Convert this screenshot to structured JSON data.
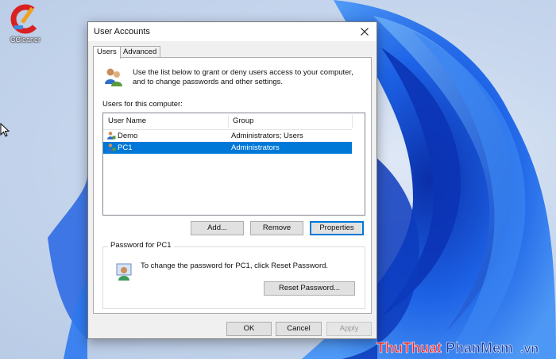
{
  "desktop": {
    "icons": [
      {
        "label": "CCleaner",
        "icon": "ccleaner-icon"
      }
    ],
    "watermark": "ThuThuatPhanMem.vn"
  },
  "dialog": {
    "title": "User Accounts",
    "tabs": [
      {
        "label": "Users",
        "active": true
      },
      {
        "label": "Advanced",
        "active": false
      }
    ],
    "intro_line1": "Use the list below to grant or deny users access to your computer,",
    "intro_line2": "and to change passwords and other settings.",
    "users_label": "Users for this computer:",
    "columns": [
      "User Name",
      "Group"
    ],
    "users": [
      {
        "name": "Demo",
        "group": "Administrators; Users",
        "selected": false
      },
      {
        "name": "PC1",
        "group": "Administrators",
        "selected": true
      }
    ],
    "list_buttons": {
      "add": "Add...",
      "remove": "Remove",
      "properties": "Properties"
    },
    "password_group": {
      "legend": "Password for PC1",
      "text": "To change the password for PC1, click Reset Password.",
      "reset_button": "Reset Password..."
    },
    "footer_buttons": {
      "ok": "OK",
      "cancel": "Cancel",
      "apply": "Apply"
    },
    "colors": {
      "selection": "#0078d7",
      "face": "#f0f0f0",
      "wallpaper_blue": "#1a5fe0"
    }
  }
}
